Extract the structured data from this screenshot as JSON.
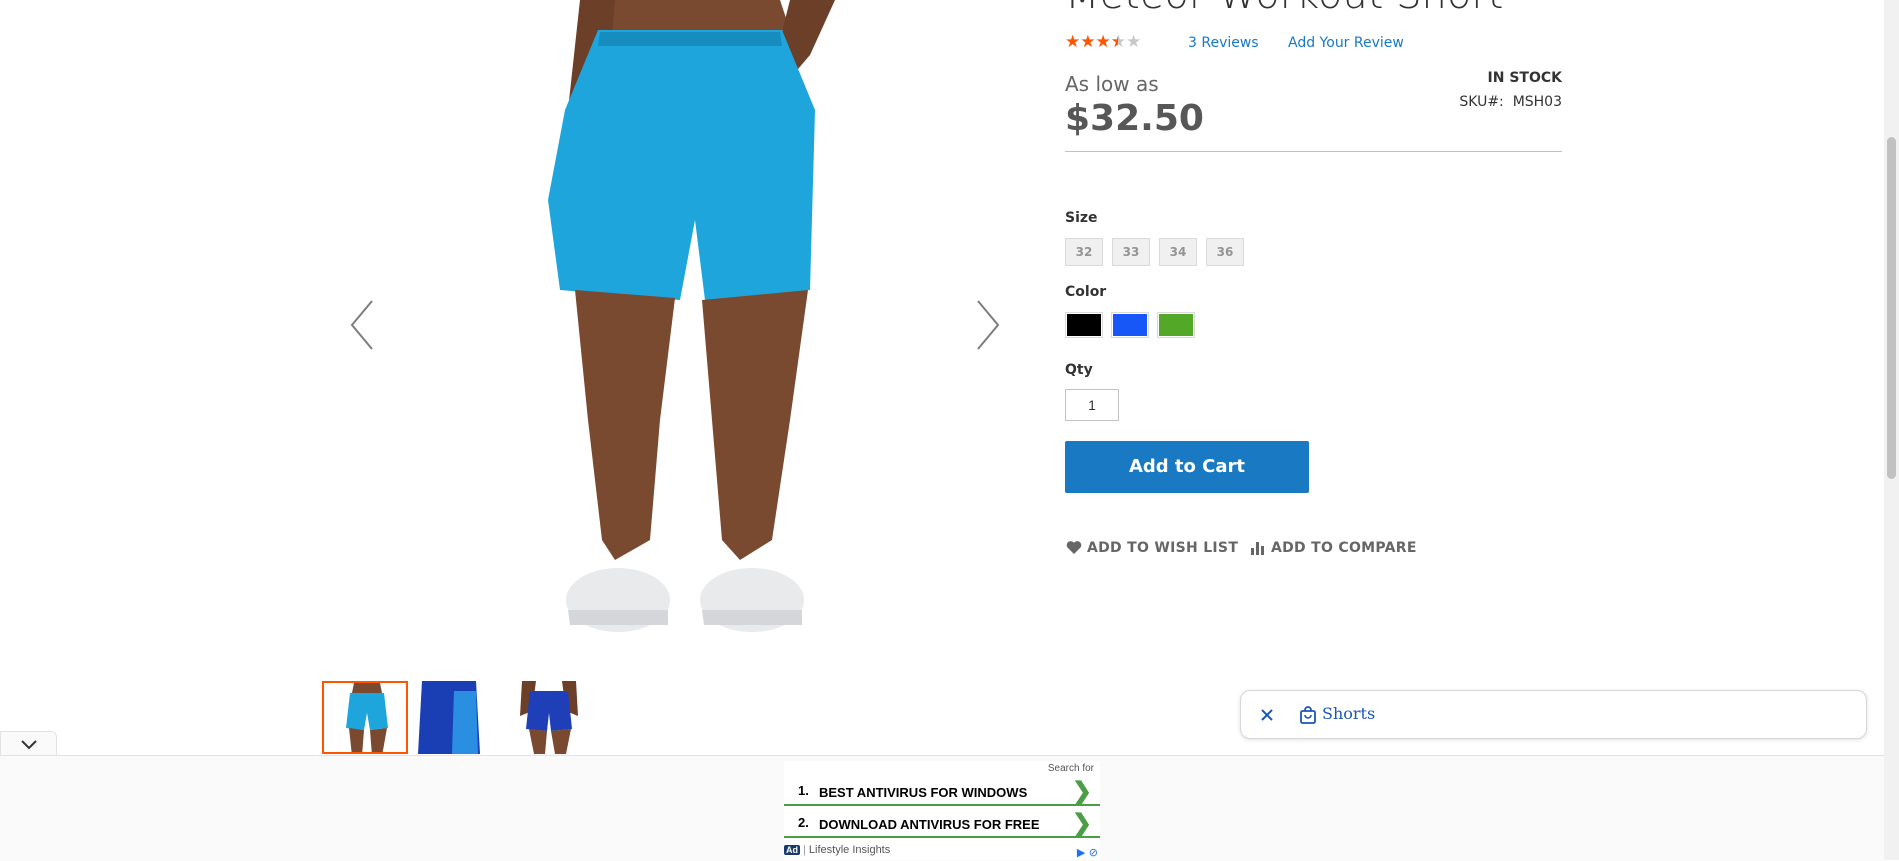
{
  "product": {
    "title": "Meteor Workout Short",
    "rating_value": 3.5,
    "rating_max": 5,
    "reviews_link": "3  Reviews",
    "add_review_link": "Add Your Review",
    "price_prefix": "As low as",
    "price": "$32.50",
    "stock_status": "IN STOCK",
    "sku_label": "SKU#:",
    "sku_value": "MSH03"
  },
  "options": {
    "size_label": "Size",
    "sizes": [
      "32",
      "33",
      "34",
      "36"
    ],
    "color_label": "Color",
    "colors": [
      {
        "name": "black",
        "hex": "#000000"
      },
      {
        "name": "blue",
        "hex": "#1857f7"
      },
      {
        "name": "green",
        "hex": "#53a828"
      }
    ],
    "qty_label": "Qty",
    "qty_value": "1"
  },
  "actions": {
    "add_to_cart": "Add to Cart",
    "add_to_wishlist": "ADD TO WISH LIST",
    "add_to_compare": "ADD TO COMPARE"
  },
  "gallery": {
    "prev_icon": "chevron-left-icon",
    "next_icon": "chevron-right-icon",
    "thumbnails": [
      "light-blue-shorts-front",
      "blue-shorts-side",
      "blue-shorts-back"
    ],
    "active_index": 0
  },
  "search_chip": {
    "text": "Shorts",
    "close_icon": "close-icon",
    "bag_icon": "shopping-bag-icon"
  },
  "ad": {
    "search_for": "Search for",
    "items": [
      {
        "num": "1.",
        "text": "BEST ANTIVIRUS FOR WINDOWS"
      },
      {
        "num": "2.",
        "text": "DOWNLOAD ANTIVIRUS FOR FREE"
      }
    ],
    "badge": "Ad",
    "source": "Lifestyle Insights"
  },
  "colors": {
    "accent_blue": "#1979c3",
    "star_orange": "#ff5501",
    "ad_green": "#4a9e45"
  }
}
